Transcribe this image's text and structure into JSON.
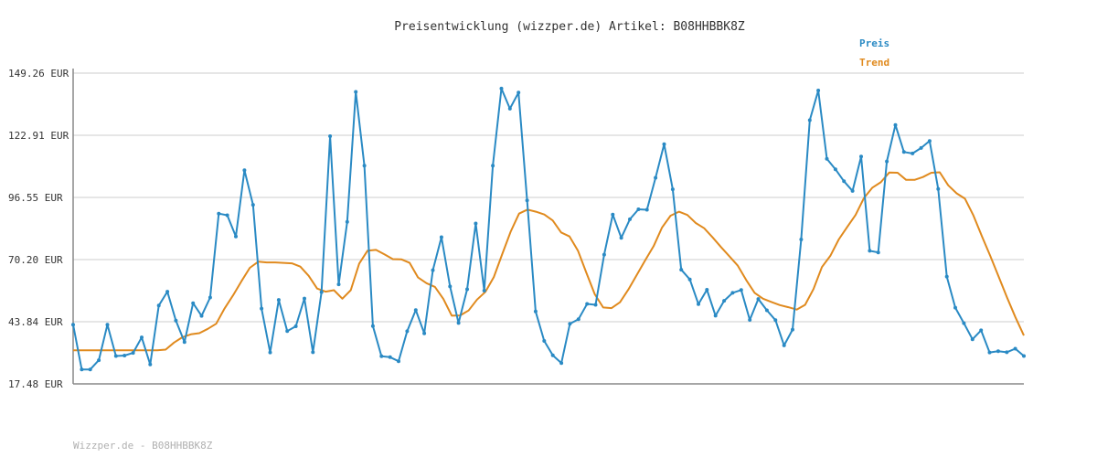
{
  "chart_data": {
    "type": "line",
    "title": "Preisentwicklung (wizzper.de) Artikel: B08HHBBK8Z",
    "footer": "Wizzper.de - B08HHBBK8Z",
    "ylim": [
      17.48,
      149.26
    ],
    "yticks": [
      17.48,
      43.84,
      70.2,
      96.55,
      122.91,
      149.26
    ],
    "ytick_labels": [
      "17.48 EUR",
      "43.84 EUR",
      "70.20 EUR",
      "96.55 EUR",
      "122.91 EUR",
      "149.26 EUR"
    ],
    "grid": true,
    "legend_position": "top-right",
    "series": [
      {
        "name": "Preis",
        "color": "#2a8ac4",
        "markers": true,
        "values": [
          42.6,
          23.6,
          23.6,
          27.5,
          42.6,
          29.3,
          29.5,
          30.6,
          37.2,
          25.7,
          50.7,
          56.6,
          44.3,
          35.2,
          51.7,
          46.3,
          54.1,
          89.7,
          89.0,
          80.0,
          108.1,
          93.4,
          49.4,
          30.8,
          53.1,
          39.9,
          41.9,
          53.7,
          30.9,
          56.4,
          122.5,
          59.7,
          86.2,
          141.3,
          110.0,
          42.0,
          29.2,
          28.8,
          27.1,
          39.8,
          48.8,
          38.9,
          65.7,
          79.7,
          58.8,
          43.3,
          57.6,
          85.5,
          57.0,
          110.0,
          142.7,
          134.2,
          141.0,
          95.3,
          48.2,
          35.7,
          29.6,
          26.3,
          43.0,
          44.9,
          51.4,
          51.0,
          72.3,
          89.3,
          79.4,
          87.3,
          91.5,
          91.3,
          104.9,
          119.1,
          100.0,
          65.9,
          61.8,
          51.3,
          57.4,
          46.4,
          52.7,
          56.1,
          57.3,
          44.6,
          53.5,
          48.7,
          44.5,
          33.8,
          40.5,
          78.7,
          129.3,
          141.9,
          112.9,
          108.5,
          103.4,
          99.3,
          113.9,
          73.9,
          73.2,
          111.8,
          127.3,
          115.8,
          115.2,
          117.5,
          120.5,
          100.1,
          63.0,
          49.8,
          43.2,
          36.4,
          40.2,
          30.8,
          31.3,
          30.9,
          32.4,
          29.3
        ]
      },
      {
        "name": "Trend",
        "color": "#e08a1e",
        "markers": false,
        "values": [
          31.7,
          31.7,
          31.7,
          31.7,
          31.7,
          31.7,
          31.7,
          31.7,
          31.7,
          31.7,
          31.7,
          32.0,
          35.0,
          37.3,
          38.5,
          39.0,
          40.8,
          43.0,
          49.5,
          55.0,
          61.0,
          66.7,
          69.3,
          69.0,
          69.0,
          68.8,
          68.6,
          67.2,
          63.3,
          57.9,
          56.6,
          57.2,
          53.6,
          57.2,
          68.5,
          74.0,
          74.3,
          72.4,
          70.4,
          70.3,
          68.8,
          62.6,
          60.2,
          58.6,
          53.5,
          46.4,
          46.5,
          48.6,
          53.2,
          56.5,
          62.8,
          72.5,
          82.0,
          89.7,
          91.4,
          90.5,
          89.3,
          86.8,
          81.7,
          80.0,
          74.0,
          64.6,
          55.5,
          49.9,
          49.6,
          52.1,
          57.5,
          63.7,
          69.9,
          75.9,
          83.8,
          88.8,
          90.5,
          89.1,
          85.7,
          83.5,
          79.6,
          75.5,
          71.6,
          67.6,
          61.5,
          56.1,
          53.6,
          52.2,
          50.9,
          50.0,
          49.0,
          51.0,
          57.7,
          67.0,
          71.8,
          78.7,
          84.0,
          89.1,
          96.3,
          100.7,
          103.0,
          107.1,
          107.0,
          104.0,
          104.0,
          105.2,
          107.0,
          107.2,
          101.7,
          98.3,
          96.0,
          88.9,
          80.2,
          71.8,
          63.0,
          54.1,
          45.7,
          38.0
        ]
      }
    ]
  }
}
